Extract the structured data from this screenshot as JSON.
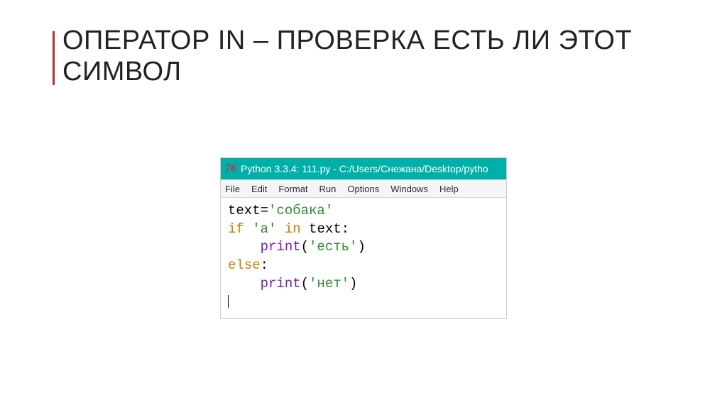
{
  "title": "ОПЕРАТОР IN – ПРОВЕРКА ЕСТЬ ЛИ ЭТОТ СИМВОЛ",
  "editor": {
    "logo": "76",
    "window_title": "Python 3.3.4: 111.py - C:/Users/Снежана/Desktop/pytho",
    "menu": [
      "File",
      "Edit",
      "Format",
      "Run",
      "Options",
      "Windows",
      "Help"
    ],
    "code": {
      "l1": {
        "a": "text=",
        "b": "'собака'"
      },
      "l2": {
        "a": "if",
        "b": " ",
        "c": "'а'",
        "d": " ",
        "e": "in",
        "f": " text:"
      },
      "l3": {
        "a": "    ",
        "b": "print",
        "c": "(",
        "d": "'есть'",
        "e": ")"
      },
      "l4": {
        "a": "else",
        "b": ":"
      },
      "l5": {
        "a": "    ",
        "b": "print",
        "c": "(",
        "d": "'нет'",
        "e": ")"
      }
    }
  }
}
